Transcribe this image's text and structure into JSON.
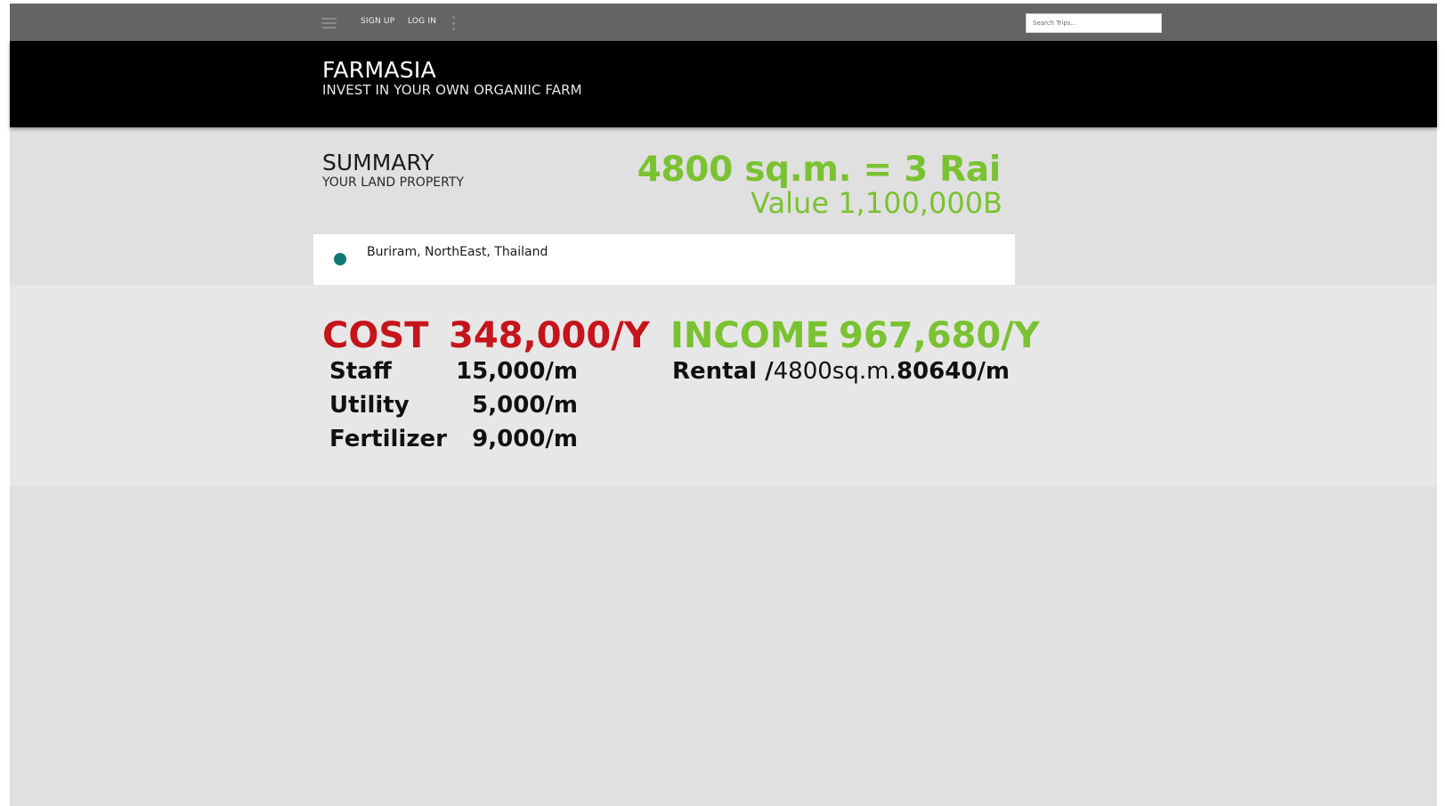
{
  "nav": {
    "signup_label": "SIGN UP",
    "login_label": "LOG IN",
    "search_placeholder": "Search Trips..."
  },
  "header": {
    "brand": "FARMASIA",
    "tagline": "INVEST IN YOUR OWN ORGANIIC FARM"
  },
  "summary": {
    "title": "SUMMARY",
    "subtitle": "YOUR LAND PROPERTY",
    "area": "4800 sq.m. = 3 Rai",
    "value": "Value 1,100,000B",
    "location": "Buriram, NorthEast, Thailand"
  },
  "cost": {
    "label": "COST",
    "total": "348,000/Y",
    "items": [
      {
        "label": "Staff",
        "value": "15,000/m"
      },
      {
        "label": "Utility",
        "value": "5,000/m"
      },
      {
        "label": "Fertilizer",
        "value": "9,000/m"
      }
    ]
  },
  "income": {
    "label": "INCOME",
    "total": "967,680/Y",
    "rental_label": "Rental /",
    "rental_unit": "4800sq.m.",
    "rental_value": "80640/m"
  },
  "colors": {
    "accent_green": "#7ac231",
    "cost_red": "#c5141b",
    "pin_teal": "#0d7a74",
    "topbar": "#646464",
    "hero": "#000000"
  }
}
